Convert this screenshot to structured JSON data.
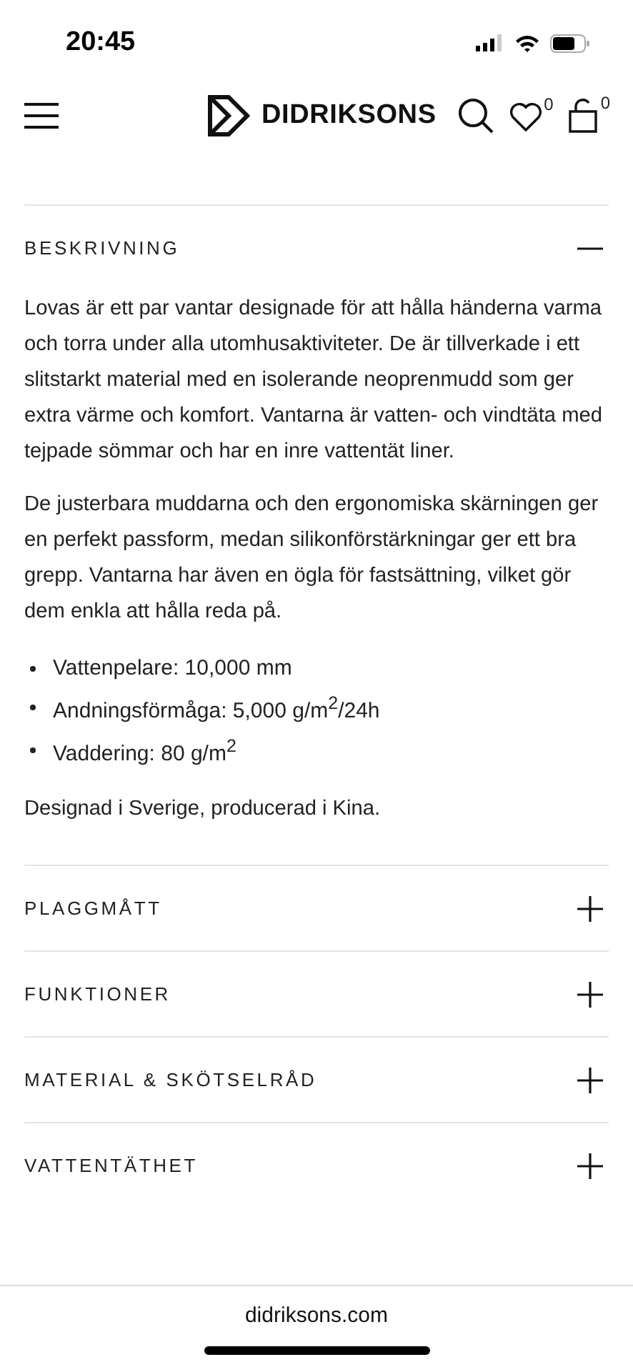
{
  "status_bar": {
    "time": "20:45"
  },
  "header": {
    "brand": "DIDRIKSONS",
    "wishlist_count": "0",
    "cart_count": "0"
  },
  "sections": [
    {
      "title": "BESKRIVNING",
      "expanded": true,
      "paragraphs": [
        "Lovas är ett par vantar designade för att hålla händerna varma och torra under alla utomhusaktiviteter. De är tillverkade i ett slitstarkt material med en isolerande neoprenmudd som ger extra värme och komfort. Vantarna är vatten- och vindtäta med tejpade sömmar och har en inre vattentät liner.",
        "De justerbara muddarna och den ergonomiska skärningen ger en perfekt passform, medan silikonförstärkningar ger ett bra grepp. Vantarna har även en ögla för fastsättning, vilket gör dem enkla att hålla reda på."
      ],
      "bullets": [
        "Vattenpelare: 10,000 mm",
        "Andningsförmåga: 5,000 g/m$^{2}$/24h",
        "Vaddering: 80 g/m$^{2}$"
      ],
      "footer": "Designad i Sverige, producerad i Kina."
    },
    {
      "title": "PLAGGMÅTT",
      "expanded": false
    },
    {
      "title": "FUNKTIONER",
      "expanded": false
    },
    {
      "title": "MATERIAL & SKÖTSELRÅD",
      "expanded": false
    },
    {
      "title": "VATTENTÄTHET",
      "expanded": false
    }
  ],
  "browser_bar": {
    "url": "didriksons.com"
  }
}
